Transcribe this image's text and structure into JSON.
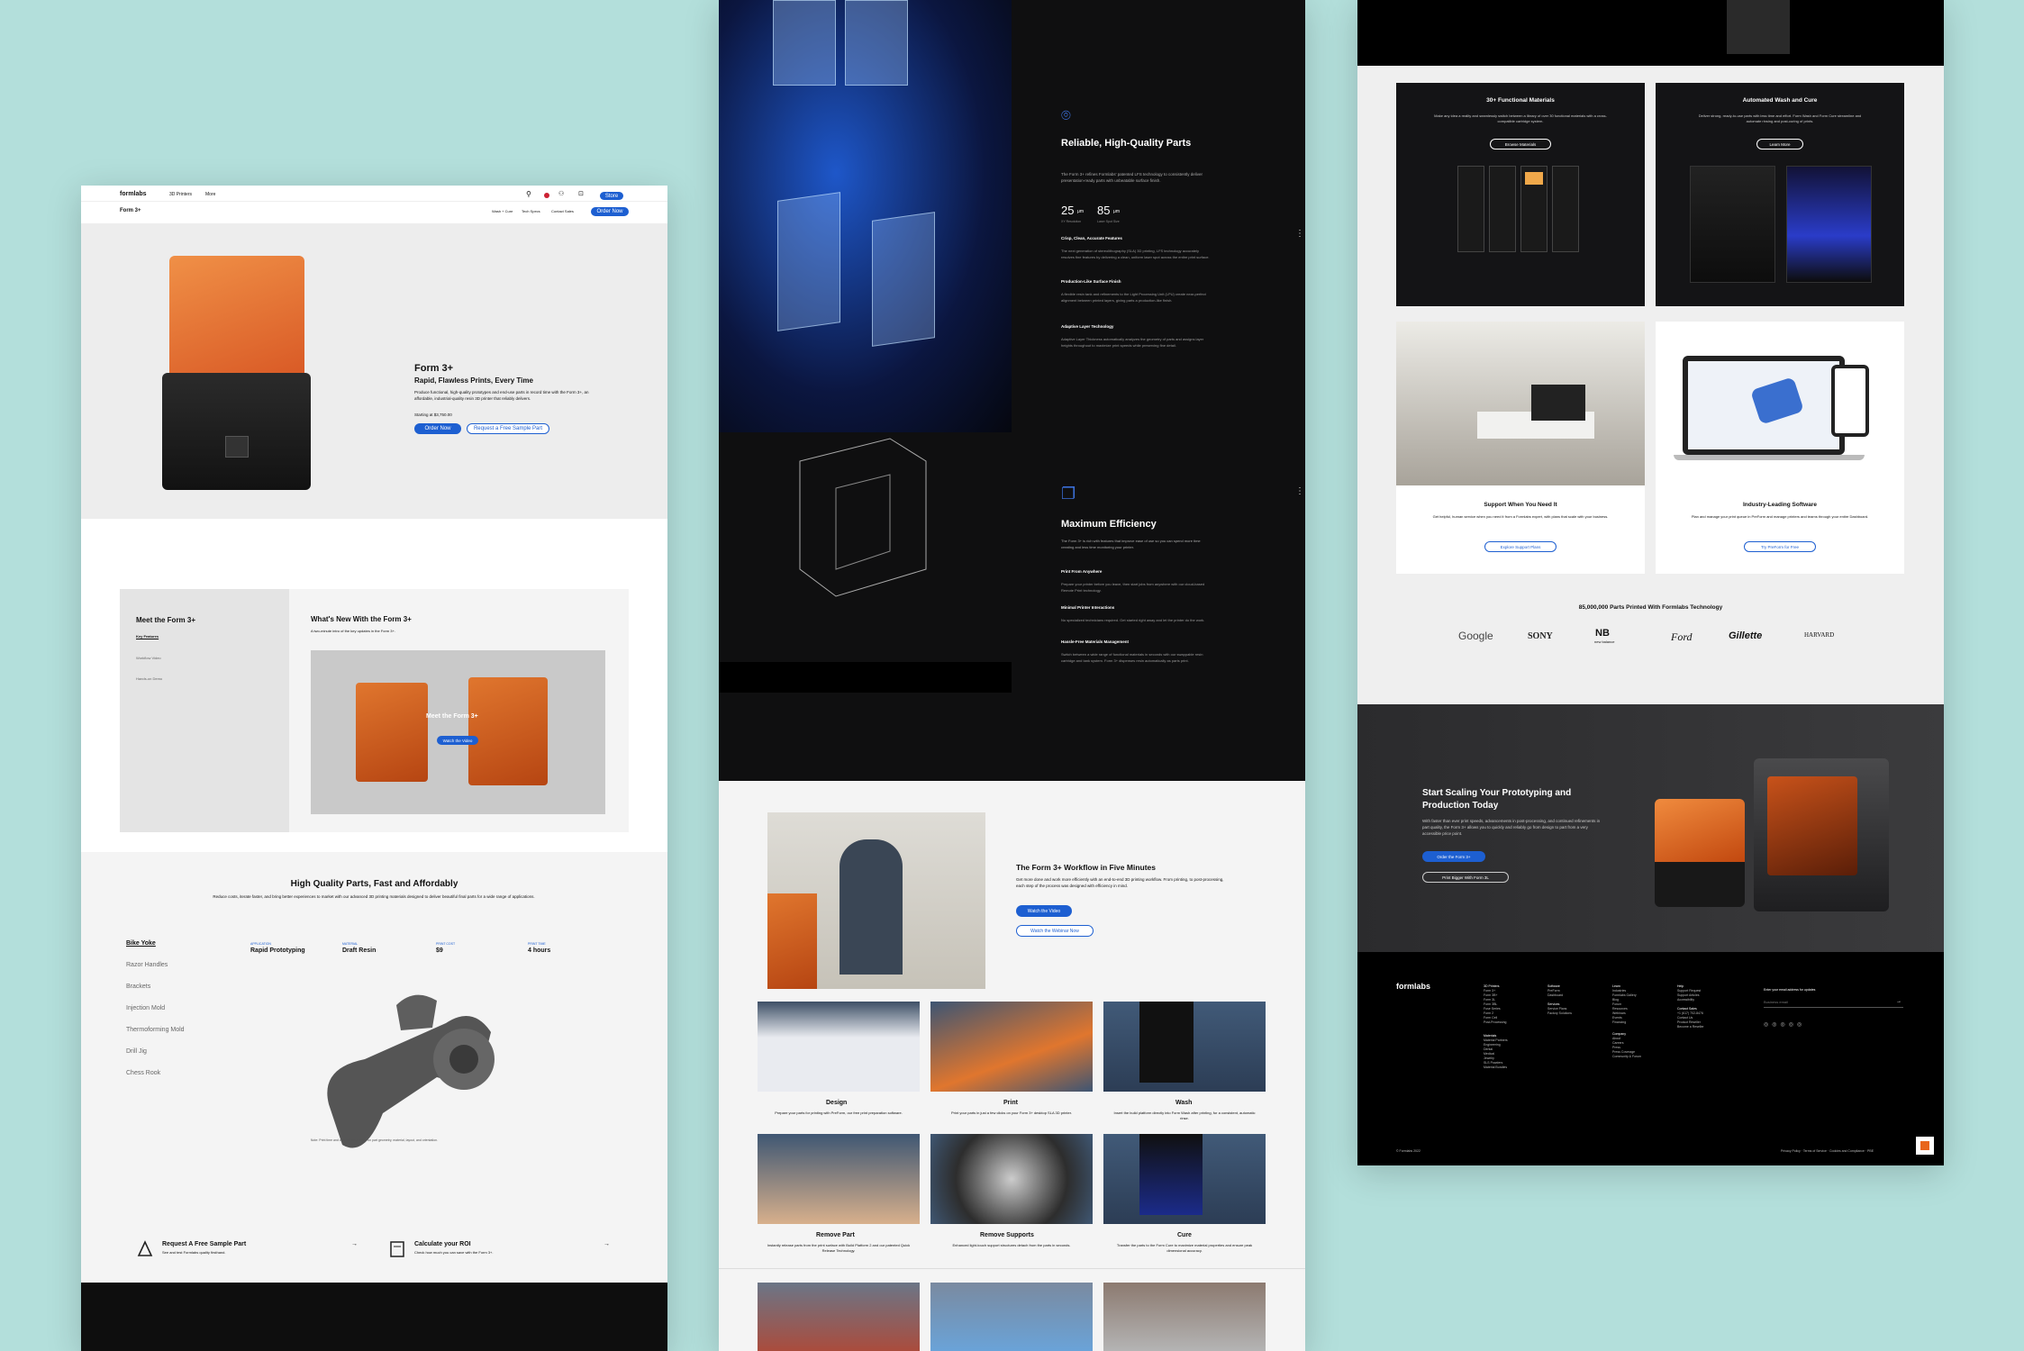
{
  "p1": {
    "nav": {
      "logo": "formlabs",
      "items": [
        "3D Printers",
        "More"
      ],
      "cta": "Store"
    },
    "sub": {
      "title": "Form 3+",
      "links": [
        "Wash + Cure",
        "Tech Specs",
        "Contact Sales"
      ],
      "cta": "Order Now"
    },
    "hero": {
      "title": "Form 3+",
      "subtitle": "Rapid, Flawless Prints, Every Time",
      "desc": "Produce functional, high-quality prototypes and end-use parts in record time with the Form 3+, an affordable, industrial-quality resin 3D printer that reliably delivers.",
      "price": "Starting at $3,750.00",
      "btn1": "Order Now",
      "btn2": "Request a Free Sample Part"
    },
    "video": {
      "side_title": "Meet the Form 3+",
      "side_items": [
        "Key Features",
        "Workflow Video",
        "Hands-on Demo"
      ],
      "title": "What's New With the Form 3+",
      "sub": "A two-minute intro of the key updates in the Form 3+.",
      "overlay": "Meet the Form 3+",
      "btn": "Watch the Video"
    },
    "parts": {
      "title": "High Quality Parts, Fast and Affordably",
      "desc": "Reduce costs, iterate faster, and bring better experiences to market with our advanced 3D printing materials designed to deliver beautiful final parts for a wide range of applications.",
      "list": [
        "Bike Yoke",
        "Razor Handles",
        "Brackets",
        "Injection Mold",
        "Thermoforming Mold",
        "Drill Jig",
        "Chess Rook"
      ],
      "specs": [
        {
          "label": "APPLICATION",
          "value": "Rapid Prototyping"
        },
        {
          "label": "MATERIAL",
          "value": "Draft Resin"
        },
        {
          "label": "PRINT COST",
          "value": "$9"
        },
        {
          "label": "PRINT TIME",
          "value": "4 hours"
        }
      ],
      "note": "Note: Print time and cost will vary based on part geometry, material, layout, and orientation."
    },
    "cta": [
      {
        "title": "Request A Free Sample Part",
        "sub": "See and test Formlabs quality firsthand.",
        "arrow": "→"
      },
      {
        "title": "Calculate your ROI",
        "sub": "Check how much you can save with the Form 3+.",
        "arrow": "→"
      }
    ]
  },
  "p2": {
    "reliable": {
      "title": "Reliable, High-Quality Parts",
      "intro": "The Form 3+ refines Formlabs' patented LFS technology to consistently deliver presentation-ready parts with unbeatable surface finish.",
      "stats": [
        {
          "num": "25",
          "unit": "μm",
          "label": "XY Resolution"
        },
        {
          "num": "85",
          "unit": "μm",
          "label": "Laser Spot Size"
        }
      ],
      "features": [
        {
          "h": "Crisp, Clean, Accurate Features",
          "p": "The next generation of stereolithography (SLA) 3D printing, LFS technology accurately resolves fine features by delivering a clean, uniform laser spot across the entire print surface."
        },
        {
          "h": "Production-Like Surface Finish",
          "p": "A flexible resin tank and refinements to the Light Processing Unit (LPU) create near-perfect alignment between printed layers, giving parts a production-like finish."
        },
        {
          "h": "Adaptive Layer Technology",
          "p": "Adaptive Layer Thickness automatically analyzes the geometry of parts and assigns layer heights throughout to maximize print speeds while preserving fine detail."
        }
      ]
    },
    "efficiency": {
      "title": "Maximum Efficiency",
      "intro": "The Form 3+ is rich with features that improve ease of use so you can spend more time creating and less time monitoring your printer.",
      "features": [
        {
          "h": "Print From Anywhere",
          "p": "Prepare your printer before you leave, then start jobs from anywhere with our cloud-based Remote Print technology."
        },
        {
          "h": "Minimal Printer Interactions",
          "p": "No specialized technicians required. Get started right away and let the printer do the work."
        },
        {
          "h": "Hassle-Free Materials Management",
          "p": "Switch between a wide range of functional materials in seconds with our swappable resin cartridge and tank system. Form 3+ dispenses resin automatically as parts print."
        }
      ]
    },
    "workflow": {
      "title": "The Form 3+ Workflow in Five Minutes",
      "desc": "Get more done and work more efficiently with an end-to-end 3D printing workflow. From printing, to post-processing, each step of the process was designed with efficiency in mind.",
      "btn1": "Watch the Video",
      "btn2": "Watch the Webinar Now"
    },
    "steps": [
      {
        "t": "Design",
        "d": "Prepare your parts for printing with PreForm, our free print preparation software."
      },
      {
        "t": "Print",
        "d": "Print your parts in just a few clicks on your Form 3+ desktop SLA 3D printer."
      },
      {
        "t": "Wash",
        "d": "Insert the build platform directly into Form Wash after printing, for a consistent, automatic rinse."
      },
      {
        "t": "Remove Part",
        "d": "Instantly release parts from the print surface with Build Platform 2 and our patented Quick Release Technology."
      },
      {
        "t": "Remove Supports",
        "d": "Enhanced light-touch support structures detach from the parts in seconds."
      },
      {
        "t": "Cure",
        "d": "Transfer the parts to the Form Cure to maximize material properties and ensure peak dimensional accuracy."
      }
    ]
  },
  "p3": {
    "cards": [
      {
        "t": "30+ Functional Materials",
        "d": "Make any idea a reality and seamlessly switch between a library of over 30 functional materials with a cross-compatible cartridge system.",
        "b": "Browse Materials"
      },
      {
        "t": "Automated Wash and Cure",
        "d": "Deliver strong, ready-to-use parts with less time and effort. Form Wash and Form Cure streamline and automate rinsing and post-curing of prints.",
        "b": "Learn More"
      },
      {
        "t": "Support When You Need It",
        "d": "Get helpful, human service when you need it from a Formlabs expert, with plans that scale with your business.",
        "b": "Explore Support Plans"
      },
      {
        "t": "Industry-Leading Software",
        "d": "Plan and manage your print queue in PreForm and manage printers and teams through your entire Dashboard.",
        "b": "Try PreForm for Free"
      }
    ],
    "brands_title": "85,000,000 Parts Printed With Formlabs Technology",
    "brands": [
      "Google",
      "SONY",
      "new balance",
      "Ford",
      "Gillette",
      "HARVARD"
    ],
    "scale": {
      "title": "Start Scaling Your Prototyping and Production Today",
      "desc": "With faster than ever print speeds, advancements in post-processing, and continued refinements in part quality, the Form 3+ allows you to quickly and reliably go from design to part from a very accessible price point.",
      "btn1": "Order the Form 3+",
      "btn2": "Print Bigger With Form 3L"
    },
    "footer": {
      "logo": "formlabs",
      "cols": [
        [
          "3D Printers",
          "Form 3+",
          "Form 3B+",
          "Form 3L",
          "Form 3BL",
          "Fuse Series",
          "Form 2",
          "Form Cell",
          "Post-Processing"
        ],
        [
          "Software",
          "PreForm",
          "Dashboard",
          "",
          "Services",
          "Service Plans",
          "Factory Solutions"
        ],
        [
          "Learn",
          "Industries",
          "Formlabs Gallery",
          "Blog",
          "Forum",
          "Resources",
          "Webinars",
          "Events",
          "Financing"
        ],
        [
          "Help",
          "Support Request",
          "Support Articles",
          "Accessibility",
          "",
          "Contact Sales",
          "+1 (617) 702-8476",
          "Contact Us",
          "Product Reseller",
          "Become a Reseller"
        ]
      ],
      "materials": [
        "Materials",
        "Material Partners",
        "Engineering",
        "Dental",
        "Medical",
        "Jewelry",
        "SLS Powders",
        "Material Bundles"
      ],
      "company": [
        "Company",
        "About",
        "Careers",
        "Press",
        "Press Coverage",
        "Community & Forum"
      ],
      "email_label": "Enter your email address for updates",
      "email_ph": "Business email",
      "copy": "© Formlabs 2022",
      "legal": "Privacy Policy · Terms of Service · Cookies and Compliance · PBE"
    }
  },
  "colors": {
    "accent": "#1d5fd1",
    "orange": "#e8661c",
    "bg": "#b3dfdb"
  }
}
